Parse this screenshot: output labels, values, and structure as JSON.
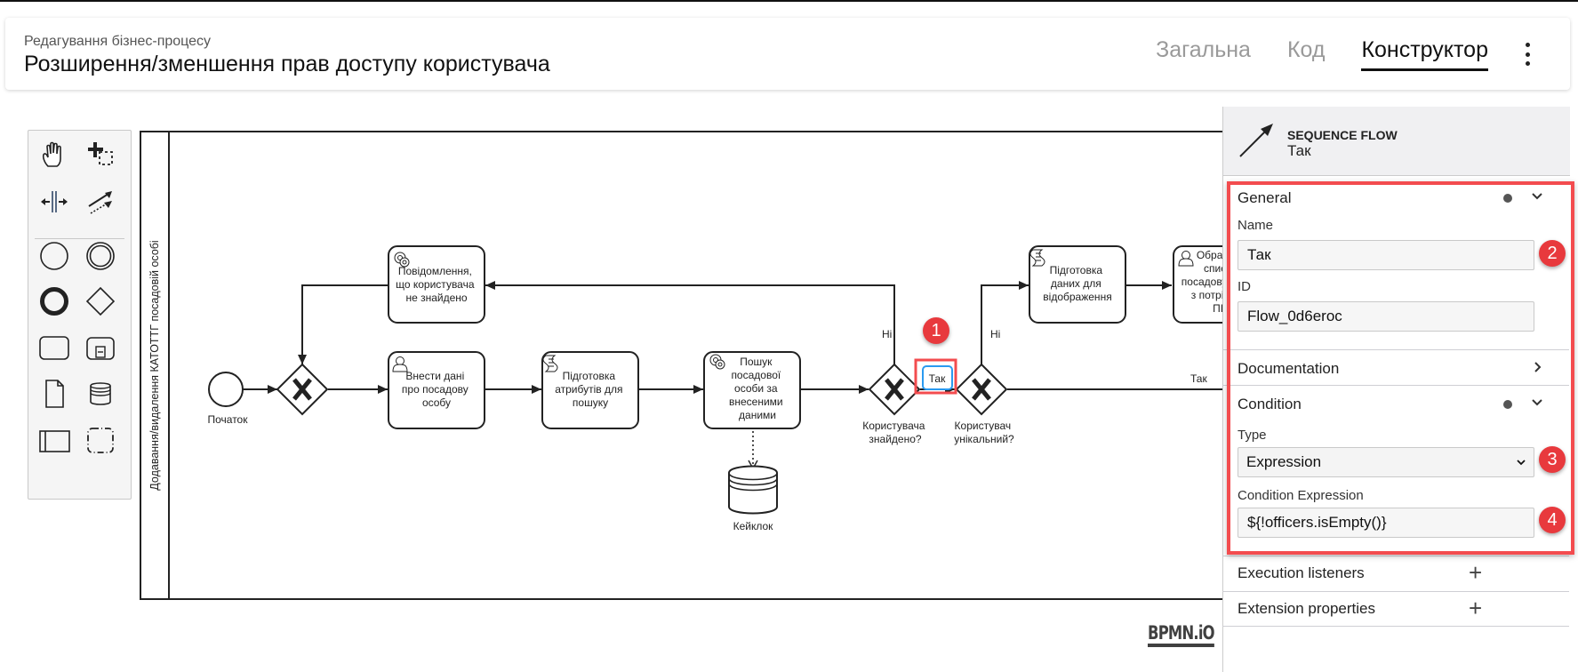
{
  "header": {
    "subtitle": "Редагування бізнес-процесу",
    "title": "Розширення/зменшення прав доступу користувача",
    "tabs": [
      {
        "label": "Загальна",
        "active": false
      },
      {
        "label": "Код",
        "active": false
      },
      {
        "label": "Конструктор",
        "active": true
      }
    ],
    "menu_icon": "more-vertical-icon"
  },
  "palette": {
    "tools": [
      {
        "name": "hand-tool",
        "icon": "hand-icon"
      },
      {
        "name": "lasso-tool",
        "icon": "lasso-icon"
      },
      {
        "name": "space-tool",
        "icon": "space-icon"
      },
      {
        "name": "global-connect-tool",
        "icon": "connect-icon"
      },
      {
        "name": "create-start-event",
        "icon": "start-event-icon"
      },
      {
        "name": "create-intermediate-event",
        "icon": "intermediate-event-icon"
      },
      {
        "name": "create-end-event",
        "icon": "end-event-icon"
      },
      {
        "name": "create-gateway",
        "icon": "gateway-icon"
      },
      {
        "name": "create-task",
        "icon": "task-icon"
      },
      {
        "name": "create-subprocess",
        "icon": "subprocess-icon"
      },
      {
        "name": "create-data-object",
        "icon": "data-object-icon"
      },
      {
        "name": "create-data-store",
        "icon": "data-store-icon"
      },
      {
        "name": "create-pool",
        "icon": "pool-icon"
      },
      {
        "name": "create-group",
        "icon": "group-icon"
      }
    ]
  },
  "diagram": {
    "lane_label": "Додавання/видалення КАТОТТГ посадовій особі",
    "start_event": "Початок",
    "tasks": {
      "notify_not_found": "Повідомлення, що користувача не знайдено",
      "enter_data": "Внести дані про посадову особу",
      "prepare_attrs": "Підготовка атрибутів для пошуку",
      "search_officer": "Пошук посадової особи за внесеними даними",
      "prepare_display": "Підготовка даних для відображення",
      "choose_from_list": "Обрати зі списку посадову особу з потрібним ПІБ"
    },
    "data_store": "Кейклок",
    "gateways": {
      "user_found": "Користувача знайдено?",
      "user_unique": "Користувач унікальний?"
    },
    "flow_labels": {
      "no1": "Ні",
      "no2": "Ні",
      "yes_selected": "Так",
      "yes2": "Так"
    },
    "watermark": "BPMN.iO"
  },
  "properties_panel": {
    "element_type": "SEQUENCE FLOW",
    "element_name": "Так",
    "groups": {
      "general": {
        "title": "General",
        "name_label": "Name",
        "name_value": "Так",
        "id_label": "ID",
        "id_value": "Flow_0d6eroc"
      },
      "documentation": {
        "title": "Documentation"
      },
      "condition": {
        "title": "Condition",
        "type_label": "Type",
        "type_value": "Expression",
        "expr_label": "Condition Expression",
        "expr_value": "${!officers.isEmpty()}"
      },
      "execution_listeners": {
        "title": "Execution listeners"
      },
      "extension_properties": {
        "title": "Extension properties"
      }
    }
  },
  "annotations": {
    "badges": [
      "1",
      "2",
      "3",
      "4"
    ],
    "highlight_color": "#f34c4f",
    "selection_color": "#2a9af0"
  }
}
